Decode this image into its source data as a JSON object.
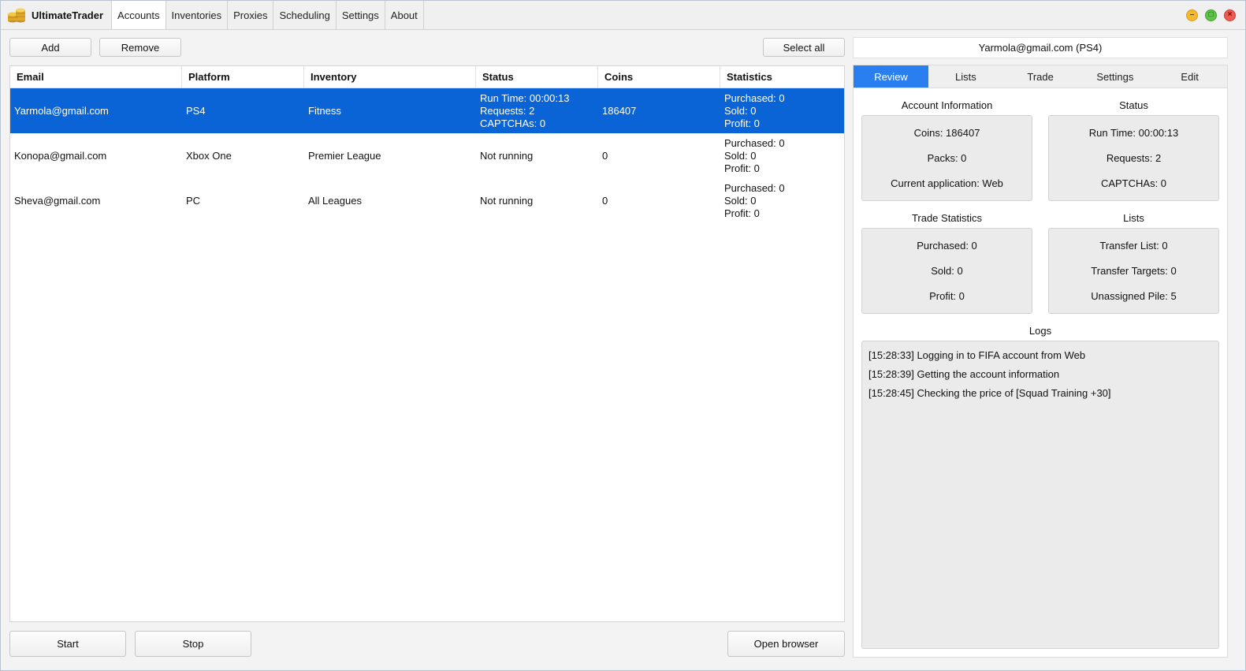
{
  "app": {
    "title": "UltimateTrader"
  },
  "menu": {
    "tabs": [
      {
        "label": "Accounts",
        "active": true
      },
      {
        "label": "Inventories",
        "active": false
      },
      {
        "label": "Proxies",
        "active": false
      },
      {
        "label": "Scheduling",
        "active": false
      },
      {
        "label": "Settings",
        "active": false
      },
      {
        "label": "About",
        "active": false
      }
    ]
  },
  "window_controls": {
    "minimize": "–",
    "maximize": "□",
    "close": "×"
  },
  "toolbar": {
    "add_label": "Add",
    "remove_label": "Remove",
    "select_all_label": "Select all"
  },
  "table": {
    "headers": {
      "email": "Email",
      "platform": "Platform",
      "inventory": "Inventory",
      "status": "Status",
      "coins": "Coins",
      "statistics": "Statistics"
    },
    "rows": [
      {
        "email": "Yarmola@gmail.com",
        "platform": "PS4",
        "inventory": "Fitness",
        "status": [
          "Run Time: 00:00:13",
          "Requests: 2",
          "CAPTCHAs: 0"
        ],
        "coins": "186407",
        "statistics": [
          "Purchased: 0",
          "Sold: 0",
          "Profit: 0"
        ],
        "selected": true
      },
      {
        "email": "Konopa@gmail.com",
        "platform": "Xbox One",
        "inventory": "Premier League",
        "status": [
          "Not running"
        ],
        "coins": "0",
        "statistics": [
          "Purchased: 0",
          "Sold: 0",
          "Profit: 0"
        ],
        "selected": false
      },
      {
        "email": "Sheva@gmail.com",
        "platform": "PC",
        "inventory": "All Leagues",
        "status": [
          "Not running"
        ],
        "coins": "0",
        "statistics": [
          "Purchased: 0",
          "Sold: 0",
          "Profit: 0"
        ],
        "selected": false
      }
    ]
  },
  "bottom": {
    "start_label": "Start",
    "stop_label": "Stop",
    "open_browser_label": "Open browser"
  },
  "details": {
    "account_title": "Yarmola@gmail.com (PS4)",
    "tabs": [
      {
        "label": "Review",
        "active": true
      },
      {
        "label": "Lists",
        "active": false
      },
      {
        "label": "Trade",
        "active": false
      },
      {
        "label": "Settings",
        "active": false
      },
      {
        "label": "Edit",
        "active": false
      }
    ],
    "account_info": {
      "title": "Account Information",
      "lines": [
        "Coins: 186407",
        "Packs: 0",
        "Current application: Web"
      ]
    },
    "status": {
      "title": "Status",
      "lines": [
        "Run Time: 00:00:13",
        "Requests: 2",
        "CAPTCHAs: 0"
      ]
    },
    "trade_stats": {
      "title": "Trade Statistics",
      "lines": [
        "Purchased: 0",
        "Sold: 0",
        "Profit: 0"
      ]
    },
    "lists": {
      "title": "Lists",
      "lines": [
        "Transfer List: 0",
        "Transfer Targets: 0",
        "Unassigned Pile: 5"
      ]
    },
    "logs": {
      "title": "Logs",
      "entries": [
        "[15:28:33] Logging in to FIFA account from Web",
        "[15:28:39] Getting the account information",
        "[15:28:45] Checking the price of [Squad Training +30]"
      ]
    }
  },
  "colors": {
    "selection": "#0a64d6",
    "active_tab": "#2a7ff0"
  }
}
